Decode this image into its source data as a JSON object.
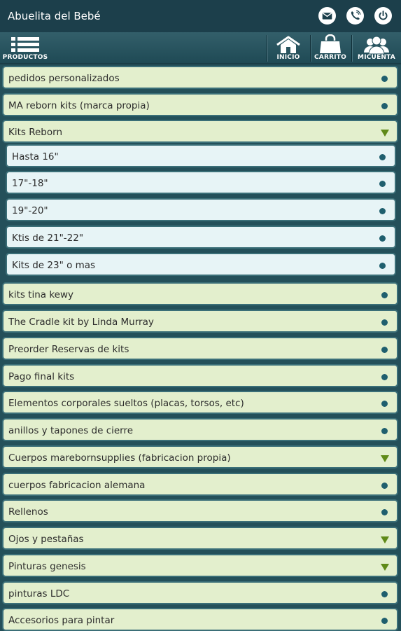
{
  "app": {
    "title": "Abuelita del Bebé"
  },
  "title_icons": [
    {
      "name": "email-icon"
    },
    {
      "name": "phone-icon"
    },
    {
      "name": "power-icon"
    }
  ],
  "nav": {
    "productos": "PRODUCTOS",
    "inicio": "INICIO",
    "carrito": "CARRITO",
    "micuenta": "MICUENTA"
  },
  "categories": [
    {
      "label": "pedidos personalizados",
      "indicator": "dot"
    },
    {
      "label": "MA reborn kits (marca propia)",
      "indicator": "dot"
    },
    {
      "label": "Kits Reborn",
      "indicator": "expanded"
    },
    {
      "label": "Hasta 16\"",
      "indicator": "dot",
      "sub": true
    },
    {
      "label": "17\"-18\"",
      "indicator": "dot",
      "sub": true
    },
    {
      "label": "19\"-20\"",
      "indicator": "dot",
      "sub": true
    },
    {
      "label": "Ktis de 21\"-22\"",
      "indicator": "dot",
      "sub": true
    },
    {
      "label": "Kits de 23\" o mas",
      "indicator": "dot",
      "sub": true
    },
    {
      "label": "kits tina kewy",
      "indicator": "dot"
    },
    {
      "label": "The Cradle kit by Linda Murray",
      "indicator": "dot"
    },
    {
      "label": "Preorder Reservas de kits",
      "indicator": "dot"
    },
    {
      "label": "Pago final kits",
      "indicator": "dot"
    },
    {
      "label": "Elementos corporales sueltos (placas, torsos, etc)",
      "indicator": "dot"
    },
    {
      "label": "anillos y tapones de cierre",
      "indicator": "dot"
    },
    {
      "label": "Cuerpos marebornsupplies (fabricacion propia)",
      "indicator": "expandable"
    },
    {
      "label": "cuerpos fabricacion alemana",
      "indicator": "dot"
    },
    {
      "label": "Rellenos",
      "indicator": "dot"
    },
    {
      "label": "Ojos y pestañas",
      "indicator": "expandable"
    },
    {
      "label": "Pinturas genesis",
      "indicator": "expandable"
    },
    {
      "label": "pinturas LDC",
      "indicator": "dot"
    },
    {
      "label": "Accesorios para pintar",
      "indicator": "dot"
    }
  ],
  "colors": {
    "title_bar": "#1c3f4b",
    "row_bg": "#e3efcd",
    "subrow_bg": "#e7f4f6",
    "row_border": "#3b6f78",
    "dot": "#1f5f6e",
    "arrow": "#5f8a18"
  }
}
